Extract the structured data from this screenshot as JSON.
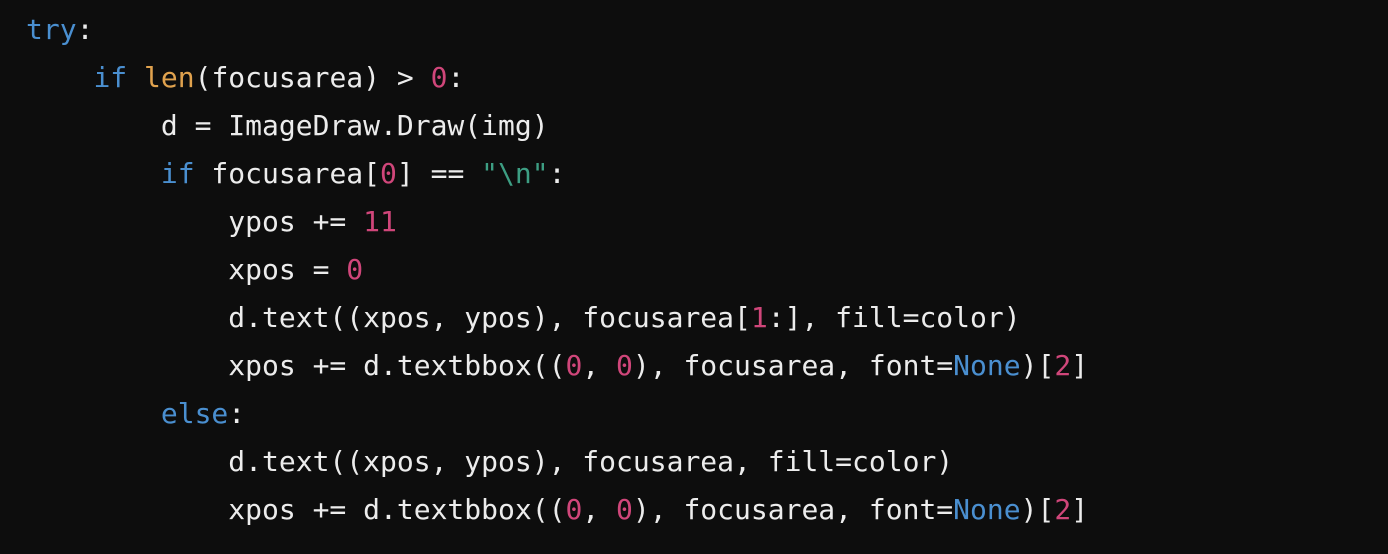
{
  "code": {
    "language": "python",
    "colors": {
      "background": "#0d0d0d",
      "plain": "#ececec",
      "keyword": "#4a8fd0",
      "builtin": "#e0a24e",
      "number": "#d0467a",
      "string": "#3d9e83"
    },
    "lines": [
      {
        "tokens": [
          {
            "t": "try",
            "c": "keyword"
          },
          {
            "t": ":",
            "c": "plain"
          }
        ]
      },
      {
        "tokens": [
          {
            "t": "    ",
            "c": "plain"
          },
          {
            "t": "if",
            "c": "keyword"
          },
          {
            "t": " ",
            "c": "plain"
          },
          {
            "t": "len",
            "c": "builtin"
          },
          {
            "t": "(focusarea) > ",
            "c": "plain"
          },
          {
            "t": "0",
            "c": "number"
          },
          {
            "t": ":",
            "c": "plain"
          }
        ]
      },
      {
        "tokens": [
          {
            "t": "        d = ImageDraw.Draw(img)",
            "c": "plain"
          }
        ]
      },
      {
        "tokens": [
          {
            "t": "        ",
            "c": "plain"
          },
          {
            "t": "if",
            "c": "keyword"
          },
          {
            "t": " focusarea[",
            "c": "plain"
          },
          {
            "t": "0",
            "c": "number"
          },
          {
            "t": "] == ",
            "c": "plain"
          },
          {
            "t": "\"\\n\"",
            "c": "string"
          },
          {
            "t": ":",
            "c": "plain"
          }
        ]
      },
      {
        "tokens": [
          {
            "t": "            ypos += ",
            "c": "plain"
          },
          {
            "t": "11",
            "c": "number"
          }
        ]
      },
      {
        "tokens": [
          {
            "t": "            xpos = ",
            "c": "plain"
          },
          {
            "t": "0",
            "c": "number"
          }
        ]
      },
      {
        "tokens": [
          {
            "t": "            d.text((xpos, ypos), focusarea[",
            "c": "plain"
          },
          {
            "t": "1",
            "c": "number"
          },
          {
            "t": ":], fill=color)",
            "c": "plain"
          }
        ]
      },
      {
        "tokens": [
          {
            "t": "            xpos += d.textbbox((",
            "c": "plain"
          },
          {
            "t": "0",
            "c": "number"
          },
          {
            "t": ", ",
            "c": "plain"
          },
          {
            "t": "0",
            "c": "number"
          },
          {
            "t": "), focusarea, font=",
            "c": "plain"
          },
          {
            "t": "None",
            "c": "keyword"
          },
          {
            "t": ")[",
            "c": "plain"
          },
          {
            "t": "2",
            "c": "number"
          },
          {
            "t": "]",
            "c": "plain"
          }
        ]
      },
      {
        "tokens": [
          {
            "t": "        ",
            "c": "plain"
          },
          {
            "t": "else",
            "c": "keyword"
          },
          {
            "t": ":",
            "c": "plain"
          }
        ]
      },
      {
        "tokens": [
          {
            "t": "            d.text((xpos, ypos), focusarea, fill=color)",
            "c": "plain"
          }
        ]
      },
      {
        "tokens": [
          {
            "t": "            xpos += d.textbbox((",
            "c": "plain"
          },
          {
            "t": "0",
            "c": "number"
          },
          {
            "t": ", ",
            "c": "plain"
          },
          {
            "t": "0",
            "c": "number"
          },
          {
            "t": "), focusarea, font=",
            "c": "plain"
          },
          {
            "t": "None",
            "c": "keyword"
          },
          {
            "t": ")[",
            "c": "plain"
          },
          {
            "t": "2",
            "c": "number"
          },
          {
            "t": "]",
            "c": "plain"
          }
        ]
      }
    ]
  }
}
